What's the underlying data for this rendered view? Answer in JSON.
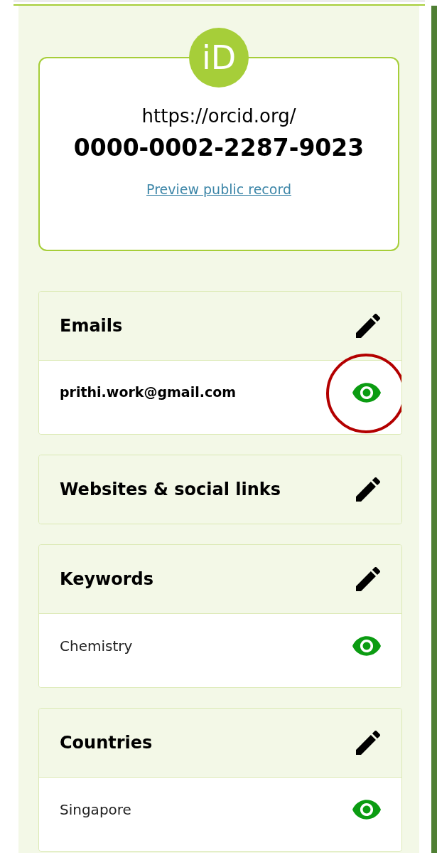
{
  "id_card": {
    "logo": "iD",
    "url": "https://orcid.org/",
    "orcid": "0000-0002-2287-9023",
    "link": "Preview public record"
  },
  "sections": [
    {
      "title": "Emails",
      "items": [
        {
          "text": "prithi.work@gmail.com",
          "primary": true,
          "public": true,
          "highlighted": true
        }
      ]
    },
    {
      "title": "Websites & social links"
    },
    {
      "title": "Keywords",
      "items": [
        {
          "text": "Chemistry",
          "primary": false,
          "public": true,
          "highlighted": false
        }
      ]
    },
    {
      "title": "Countries",
      "items": [
        {
          "text": "Singapore",
          "primary": false,
          "public": true,
          "highlighted": false
        }
      ]
    }
  ]
}
